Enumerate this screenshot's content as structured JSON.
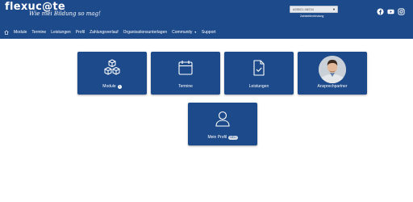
{
  "header": {
    "logo_text": "flexuc@te",
    "slogan": "Wie mei Bildung so mag!",
    "account_select": "#28521-08234",
    "account_sub": "Zahlstellenbindung",
    "social": [
      "facebook-icon",
      "youtube-icon",
      "instagram-icon"
    ]
  },
  "nav": {
    "home_icon": "home-icon",
    "items": [
      {
        "label": "Module"
      },
      {
        "label": "Termine"
      },
      {
        "label": "Leistungen"
      },
      {
        "label": "Profil"
      },
      {
        "label": "Zahlungsverlauf"
      },
      {
        "label": "Organisationsunterlagen"
      },
      {
        "label": "Community",
        "dropdown": true
      },
      {
        "label": "Support"
      }
    ]
  },
  "tiles": [
    {
      "label": "Module",
      "badge": "1",
      "icon": "cubes-icon"
    },
    {
      "label": "Termine",
      "icon": "calendar-icon"
    },
    {
      "label": "Leistungen",
      "icon": "document-check-icon"
    },
    {
      "label": "Ansprechpartner",
      "icon": "avatar-photo"
    },
    {
      "label": "Mein Profil",
      "badge": "NEU",
      "icon": "user-icon"
    }
  ],
  "colors": {
    "brand": "#1d4a8a",
    "background": "#ffffff"
  }
}
